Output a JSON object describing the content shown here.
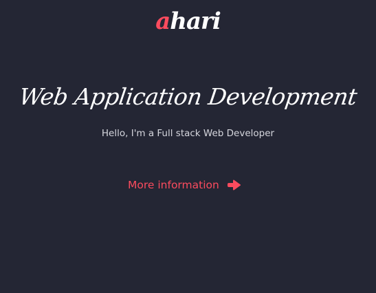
{
  "logo": {
    "first_letter": "a",
    "rest": "hari"
  },
  "hero": {
    "headline": "Web Application Development",
    "subline": "Hello, I'm a Full stack Web Developer",
    "cta_label": "More information",
    "cta_icon": "arrow-right-icon"
  },
  "colors": {
    "background": "#242634",
    "accent": "#fb4b5e",
    "text": "#ffffff",
    "muted_text": "#d6d7de"
  }
}
